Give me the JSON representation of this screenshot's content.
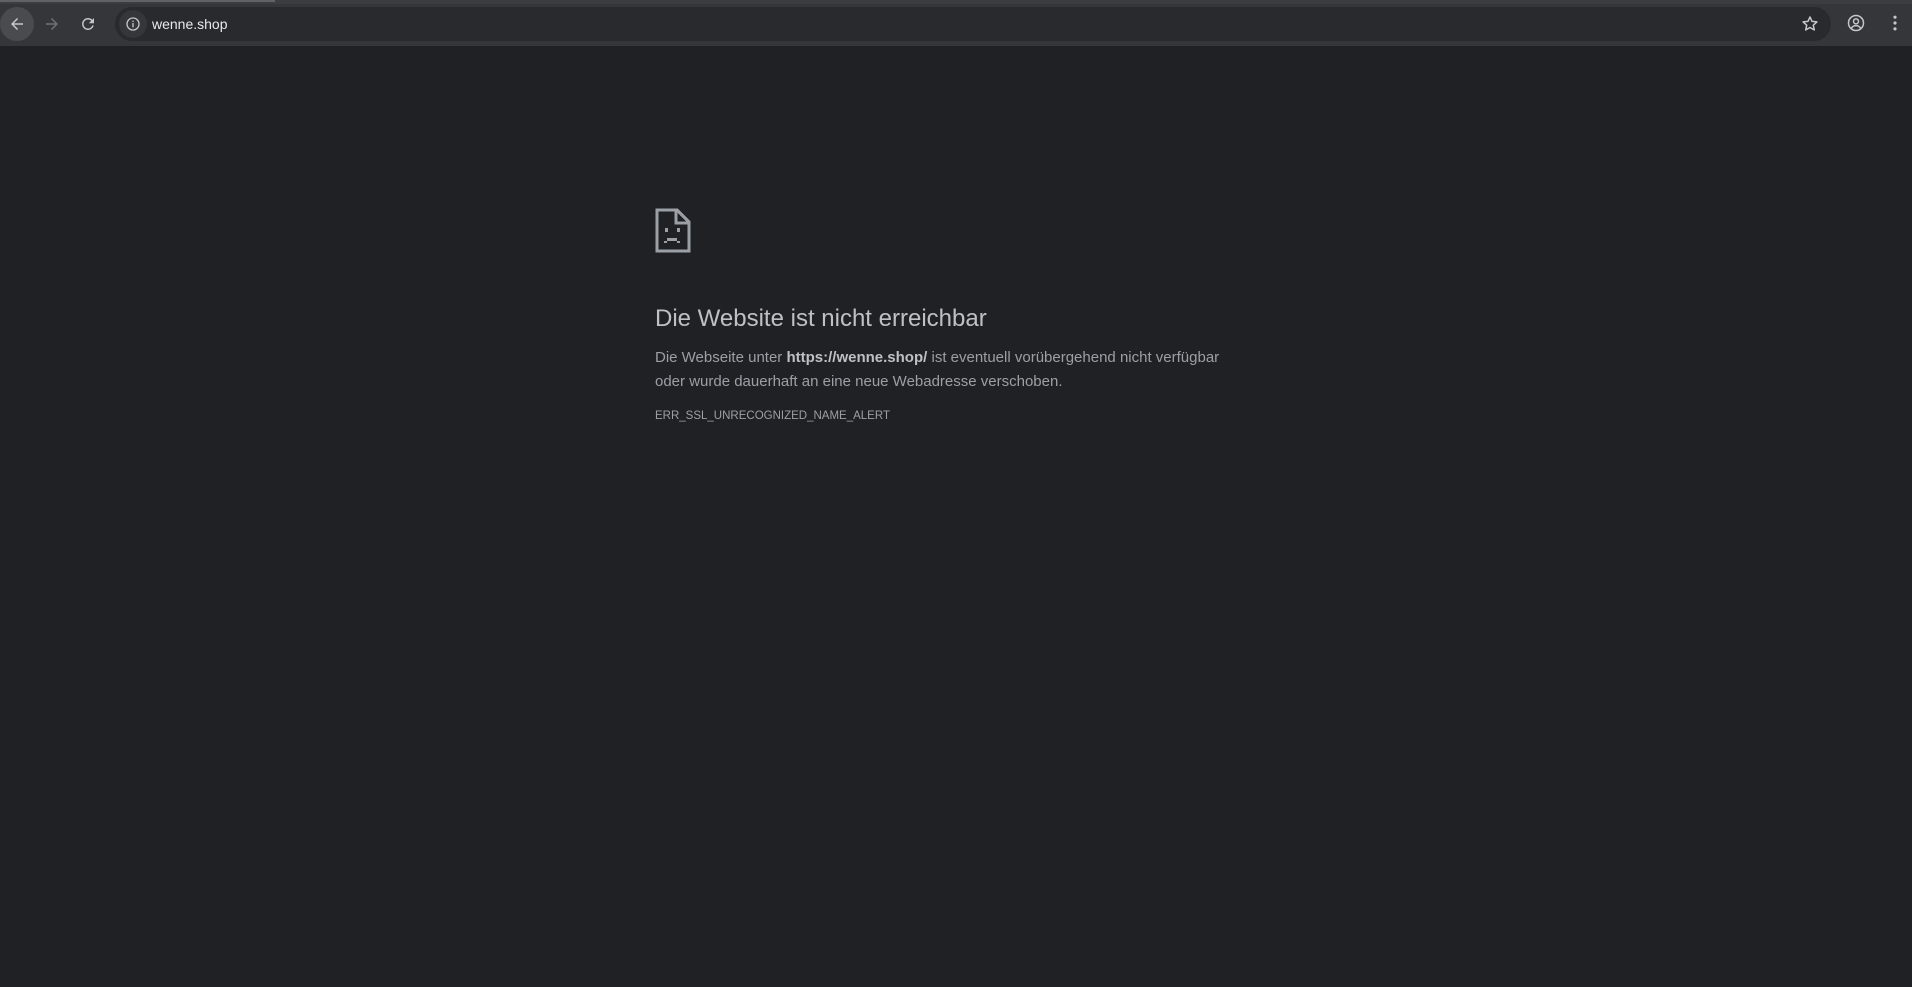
{
  "browser": {
    "url": "wenne.shop",
    "icons": {
      "back": "arrow-left-icon",
      "forward": "arrow-right-icon",
      "reload": "reload-icon",
      "site_info": "info-icon",
      "bookmark": "star-icon",
      "profile": "account-icon",
      "menu": "kebab-menu-icon"
    }
  },
  "error_page": {
    "title": "Die Website ist nicht erreichbar",
    "description_prefix": "Die Webseite unter ",
    "description_url": "https://wenne.shop/",
    "description_suffix": " ist eventuell vorübergehend nicht verfügbar oder wurde dauerhaft an eine neue Webadresse verschoben.",
    "error_code": "ERR_SSL_UNRECOGNIZED_NAME_ALERT"
  },
  "colors": {
    "page_background": "#202124",
    "toolbar_background": "#35363a",
    "omnibox_background": "#282a2d",
    "title_text": "#bdc1c6",
    "body_text": "#9aa0a6"
  }
}
